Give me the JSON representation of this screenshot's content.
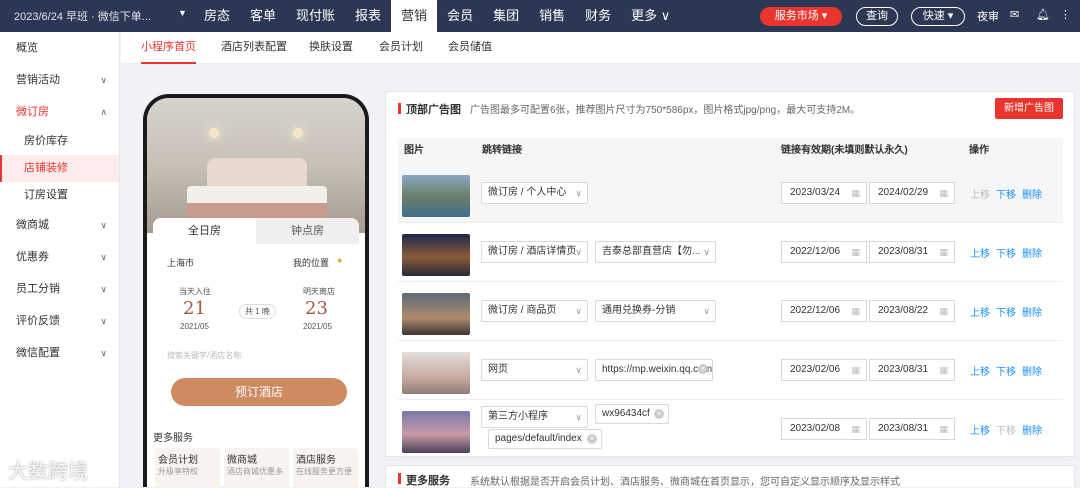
{
  "topbar": {
    "date_text": "2023/6/24 早班 · 微信下单...",
    "nav": [
      "房态",
      "客单",
      "现付账",
      "报表",
      "营销",
      "会员",
      "集团",
      "销售",
      "财务",
      "更多 ∨"
    ],
    "active_nav": "营销",
    "service_market": "服务市场 ▾",
    "query": "查询",
    "quick": "快速 ▾",
    "night_audit": "夜审",
    "colors": {
      "topbar": "#2c3753",
      "accent": "#e8352e",
      "link": "#1890ff"
    }
  },
  "sidebar": {
    "items": [
      {
        "label": "概览"
      },
      {
        "label": "营销活动",
        "chevron": "∨"
      },
      {
        "label": "微订房",
        "chevron": "∧",
        "open": true
      },
      {
        "sub": "房价库存"
      },
      {
        "sub": "店铺装修",
        "active": true
      },
      {
        "sub": "订房设置"
      },
      {
        "label": "微商城",
        "chevron": "∨"
      },
      {
        "label": "优惠券",
        "chevron": "∨"
      },
      {
        "label": "员工分销",
        "chevron": "∨"
      },
      {
        "label": "评价反馈",
        "chevron": "∨"
      },
      {
        "label": "微信配置",
        "chevron": "∨"
      }
    ]
  },
  "subtabs": [
    "小程序首页",
    "酒店列表配置",
    "换肤设置",
    "会员计划",
    "会员储值"
  ],
  "phone": {
    "tab_all_day": "全日房",
    "tab_hourly": "钟点房",
    "city": "上海市",
    "my_location": "我的位置",
    "checkin_label": "当天入住",
    "checkin_day": "21",
    "checkin_month": "2021/05",
    "nights": "共 1 晚",
    "checkout_label": "明天离店",
    "checkout_day": "23",
    "checkout_month": "2021/05",
    "search_placeholder": "搜索关键字/酒店名称",
    "book_button": "预订酒店",
    "more_services": "更多服务",
    "services": [
      {
        "title": "会员计划",
        "desc": "升级享特权"
      },
      {
        "title": "微商城",
        "desc": "酒店商城优惠多"
      },
      {
        "title": "酒店服务",
        "desc": "在线服务更方便"
      }
    ]
  },
  "ad_panel": {
    "title": "顶部广告图",
    "tip": "广告图最多可配置6张，推荐图片尺寸为750*586px，图片格式jpg/png，最大可支持2M。",
    "new_button": "新增广告图",
    "headers": [
      "图片",
      "跳转链接",
      "链接有效期(未填则默认永久)",
      "操作"
    ],
    "actions": {
      "up": "上移",
      "down": "下移",
      "delete": "删除"
    },
    "rows": [
      {
        "link_type": "微订房 / 个人中心",
        "start": "2023/03/24",
        "end": "2024/02/29",
        "up_disabled": true
      },
      {
        "link_type": "微订房 / 酒店详情页",
        "target": "吉泰总部直营店【勿...",
        "start": "2022/12/06",
        "end": "2023/08/31"
      },
      {
        "link_type": "微订房 / 商品页",
        "target": "通用兑换券-分销",
        "start": "2022/12/06",
        "end": "2023/08/22"
      },
      {
        "link_type": "网页",
        "target": "https://mp.weixin.qq.com",
        "start": "2023/02/06",
        "end": "2023/08/31"
      },
      {
        "link_type": "第三方小程序",
        "appid": "wx96434cf",
        "path": "pages/default/index",
        "start": "2023/02/08",
        "end": "2023/08/31",
        "down_disabled": true
      }
    ]
  },
  "services_panel": {
    "title": "更多服务",
    "tip": "系统默认根据是否开启会员计划、酒店服务、微商城在首页显示，您可自定义显示顺序及显示样式"
  },
  "watermark": "大数跨境"
}
